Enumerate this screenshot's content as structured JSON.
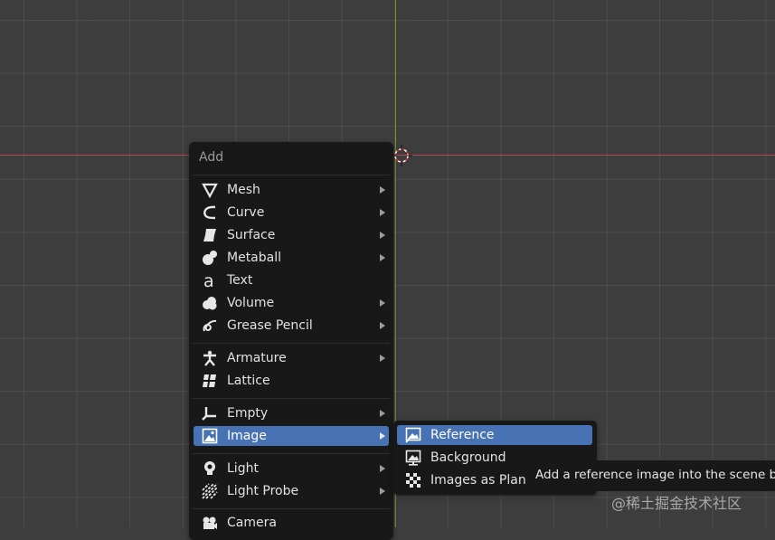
{
  "menu": {
    "title": "Add",
    "items": [
      {
        "label": "Mesh",
        "icon": "mesh-icon",
        "submenu": true
      },
      {
        "label": "Curve",
        "icon": "curve-icon",
        "submenu": true
      },
      {
        "label": "Surface",
        "icon": "surface-icon",
        "submenu": true
      },
      {
        "label": "Metaball",
        "icon": "metaball-icon",
        "submenu": true
      },
      {
        "label": "Text",
        "icon": "text-icon",
        "submenu": false
      },
      {
        "label": "Volume",
        "icon": "volume-icon",
        "submenu": true
      },
      {
        "label": "Grease Pencil",
        "icon": "grease-pencil-icon",
        "submenu": true
      },
      {
        "label": "Armature",
        "icon": "armature-icon",
        "submenu": true
      },
      {
        "label": "Lattice",
        "icon": "lattice-icon",
        "submenu": false
      },
      {
        "label": "Empty",
        "icon": "empty-icon",
        "submenu": true
      },
      {
        "label": "Image",
        "icon": "image-icon",
        "submenu": true,
        "active": true
      },
      {
        "label": "Light",
        "icon": "light-icon",
        "submenu": true
      },
      {
        "label": "Light Probe",
        "icon": "light-probe-icon",
        "submenu": true
      },
      {
        "label": "Camera",
        "icon": "camera-icon",
        "submenu": false
      }
    ]
  },
  "submenu": {
    "items": [
      {
        "label": "Reference",
        "icon": "reference-image-icon",
        "active": true
      },
      {
        "label": "Background",
        "icon": "background-image-icon"
      },
      {
        "label": "Images as Planes",
        "icon": "checker-icon"
      }
    ]
  },
  "tooltip": {
    "text": "Add a reference image into the scene bet"
  },
  "watermark": {
    "text": "@稀土掘金技术社区"
  },
  "colors": {
    "viewport_bg": "#3d3d3d",
    "grid_line": "#5a5a5a",
    "x_axis": "#b54650",
    "y_axis": "#6c9a2c",
    "menu_bg": "#181818",
    "highlight": "#4772b3"
  }
}
